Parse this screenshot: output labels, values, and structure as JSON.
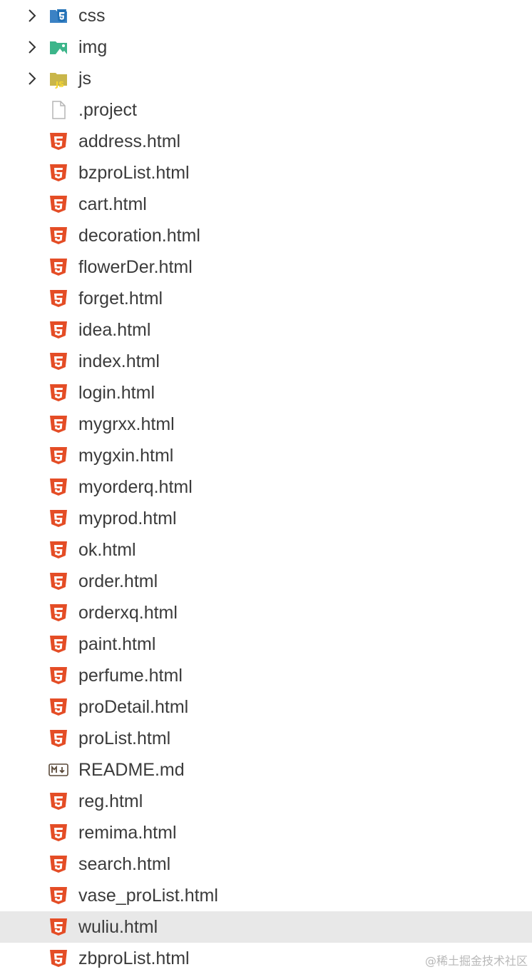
{
  "explorer": {
    "items": [
      {
        "label": "css",
        "kind": "folder",
        "icon": "css-folder-icon",
        "expandable": true
      },
      {
        "label": "img",
        "kind": "folder",
        "icon": "image-folder-icon",
        "expandable": true
      },
      {
        "label": "js",
        "kind": "folder",
        "icon": "js-folder-icon",
        "expandable": true
      },
      {
        "label": ".project",
        "kind": "file",
        "icon": "generic-file-icon"
      },
      {
        "label": "address.html",
        "kind": "file",
        "icon": "html5-icon"
      },
      {
        "label": "bzproList.html",
        "kind": "file",
        "icon": "html5-icon"
      },
      {
        "label": "cart.html",
        "kind": "file",
        "icon": "html5-icon"
      },
      {
        "label": "decoration.html",
        "kind": "file",
        "icon": "html5-icon"
      },
      {
        "label": "flowerDer.html",
        "kind": "file",
        "icon": "html5-icon"
      },
      {
        "label": "forget.html",
        "kind": "file",
        "icon": "html5-icon"
      },
      {
        "label": "idea.html",
        "kind": "file",
        "icon": "html5-icon"
      },
      {
        "label": "index.html",
        "kind": "file",
        "icon": "html5-icon"
      },
      {
        "label": "login.html",
        "kind": "file",
        "icon": "html5-icon"
      },
      {
        "label": "mygrxx.html",
        "kind": "file",
        "icon": "html5-icon"
      },
      {
        "label": "mygxin.html",
        "kind": "file",
        "icon": "html5-icon"
      },
      {
        "label": "myorderq.html",
        "kind": "file",
        "icon": "html5-icon"
      },
      {
        "label": "myprod.html",
        "kind": "file",
        "icon": "html5-icon"
      },
      {
        "label": "ok.html",
        "kind": "file",
        "icon": "html5-icon"
      },
      {
        "label": "order.html",
        "kind": "file",
        "icon": "html5-icon"
      },
      {
        "label": "orderxq.html",
        "kind": "file",
        "icon": "html5-icon"
      },
      {
        "label": "paint.html",
        "kind": "file",
        "icon": "html5-icon"
      },
      {
        "label": "perfume.html",
        "kind": "file",
        "icon": "html5-icon"
      },
      {
        "label": "proDetail.html",
        "kind": "file",
        "icon": "html5-icon"
      },
      {
        "label": "proList.html",
        "kind": "file",
        "icon": "html5-icon"
      },
      {
        "label": "README.md",
        "kind": "file",
        "icon": "markdown-icon"
      },
      {
        "label": "reg.html",
        "kind": "file",
        "icon": "html5-icon"
      },
      {
        "label": "remima.html",
        "kind": "file",
        "icon": "html5-icon"
      },
      {
        "label": "search.html",
        "kind": "file",
        "icon": "html5-icon"
      },
      {
        "label": "vase_proList.html",
        "kind": "file",
        "icon": "html5-icon"
      },
      {
        "label": "wuliu.html",
        "kind": "file",
        "icon": "html5-icon",
        "selected": true
      },
      {
        "label": "zbproList.html",
        "kind": "file",
        "icon": "html5-icon"
      }
    ]
  },
  "watermark": "@稀土掘金技术社区",
  "colors": {
    "html5": "#e44d26",
    "css_folder": "#3b82c4",
    "img_folder": "#3cb58a",
    "js_folder": "#c9b64a",
    "js_text": "#f5d630",
    "selected_row": "#e8e8e8",
    "text": "#3b3b3b"
  }
}
